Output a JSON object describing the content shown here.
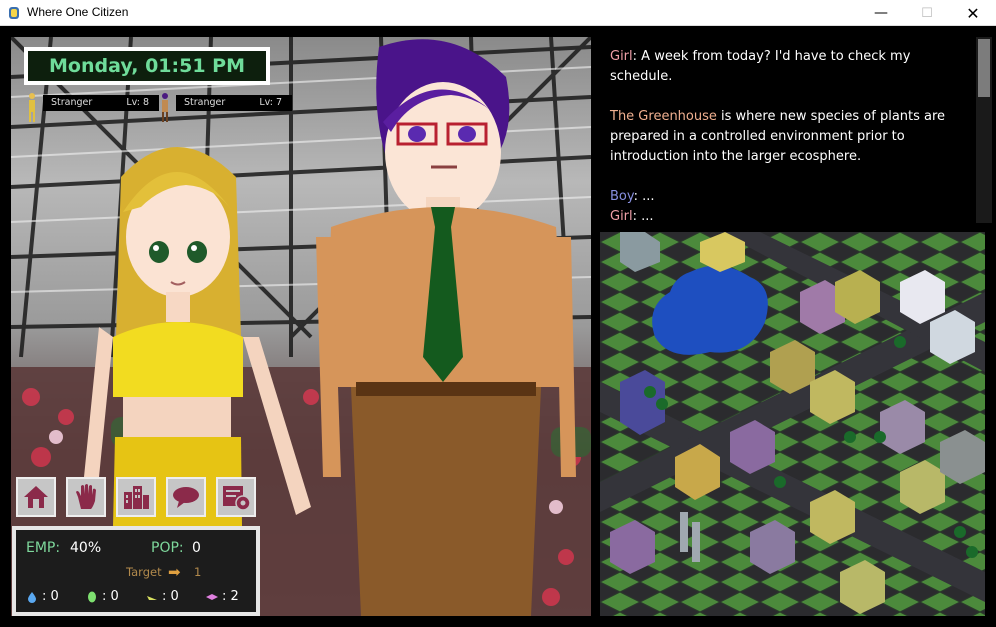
{
  "window": {
    "title": "Where One Citizen",
    "minimize_glyph": "—",
    "maximize_glyph": "☐",
    "close_glyph": "✕"
  },
  "hud": {
    "clock": "Monday, 01:51 PM",
    "strangers": [
      {
        "name": "Stranger",
        "level": "Lv: 8"
      },
      {
        "name": "Stranger",
        "level": "Lv: 7"
      }
    ],
    "actions": [
      {
        "icon": "home-icon"
      },
      {
        "icon": "hand-icon"
      },
      {
        "icon": "buildings-icon"
      },
      {
        "icon": "speech-bubble-icon"
      },
      {
        "icon": "settings-panel-icon"
      }
    ],
    "stats": {
      "emp_label": "EMP:",
      "emp_value": "40%",
      "pop_label": "POP:",
      "pop_value": "0",
      "target_label": "Target",
      "target_value": "1",
      "resources": [
        {
          "icon": "blue-drop-icon",
          "color": "#5aa8f0",
          "value": ": 0"
        },
        {
          "icon": "green-leaf-icon",
          "color": "#7ee070",
          "value": ": 0"
        },
        {
          "icon": "yellow-shard-icon",
          "color": "#d8e060",
          "value": ": 0"
        },
        {
          "icon": "pink-crystal-icon",
          "color": "#e080e0",
          "value": ": 2"
        }
      ]
    }
  },
  "dialogue": [
    {
      "speaker": "Girl",
      "text": ": A week from today? I'd have to check my schedule."
    },
    {
      "location": "The Greenhouse",
      "text": " is where new species of plants are prepared in a controlled environment prior to introduction into the larger ecosphere."
    },
    {
      "speaker": "Boy",
      "text": ": ..."
    },
    {
      "speaker": "Girl",
      "text": ": ..."
    }
  ],
  "colors": {
    "clock_text": "#6fdc9a",
    "stat_label": "#7ed89c",
    "target_text": "#b28a4c",
    "girl_name": "#f0a0a8",
    "boy_name": "#8890e0",
    "location_name": "#f0b090",
    "water": "#1e4fc0",
    "grass": "#4c8a3c"
  }
}
